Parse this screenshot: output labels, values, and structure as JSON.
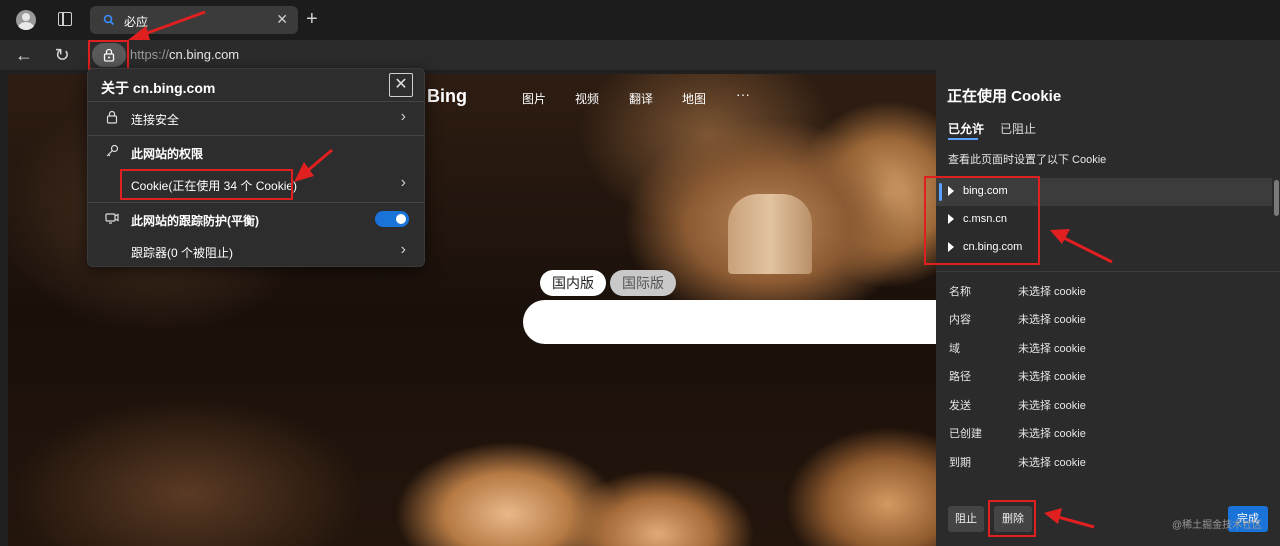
{
  "browser": {
    "tab_title": "必应",
    "url_scheme": "https://",
    "url_host": "cn.bing.com"
  },
  "bing": {
    "logo": "Bing",
    "nav": [
      "图片",
      "视频",
      "翻译",
      "地图",
      "···"
    ],
    "market_tabs": [
      "国内版",
      "国际版"
    ],
    "active_market": "国内版"
  },
  "site_info": {
    "title": "关于 cn.bing.com",
    "connection": "连接安全",
    "permissions": "此网站的权限",
    "cookies": "Cookie(正在使用 34 个 Cookie)",
    "tracking": "此网站的跟踪防护(平衡)",
    "trackers": "跟踪器(0 个被阻止)",
    "tracking_enabled": true
  },
  "cookie_panel": {
    "title": "正在使用 Cookie",
    "tab_allowed": "已允许",
    "tab_blocked": "已阻止",
    "description": "查看此页面时设置了以下 Cookie",
    "domains": [
      "bing.com",
      "c.msn.cn",
      "cn.bing.com"
    ],
    "selected_domain": "bing.com",
    "details": [
      {
        "key": "名称",
        "value": "未选择 cookie"
      },
      {
        "key": "内容",
        "value": "未选择 cookie"
      },
      {
        "key": "域",
        "value": "未选择 cookie"
      },
      {
        "key": "路径",
        "value": "未选择 cookie"
      },
      {
        "key": "发送",
        "value": "未选择 cookie"
      },
      {
        "key": "已创建",
        "value": "未选择 cookie"
      },
      {
        "key": "到期",
        "value": "未选择 cookie"
      }
    ],
    "btn_block": "阻止",
    "btn_delete": "删除",
    "btn_done": "完成"
  },
  "watermark": "@稀土掘金技术社区",
  "colors": {
    "accent": "#1a73d9",
    "annotation": "#e02020",
    "panel_bg": "#2b2b2b"
  }
}
